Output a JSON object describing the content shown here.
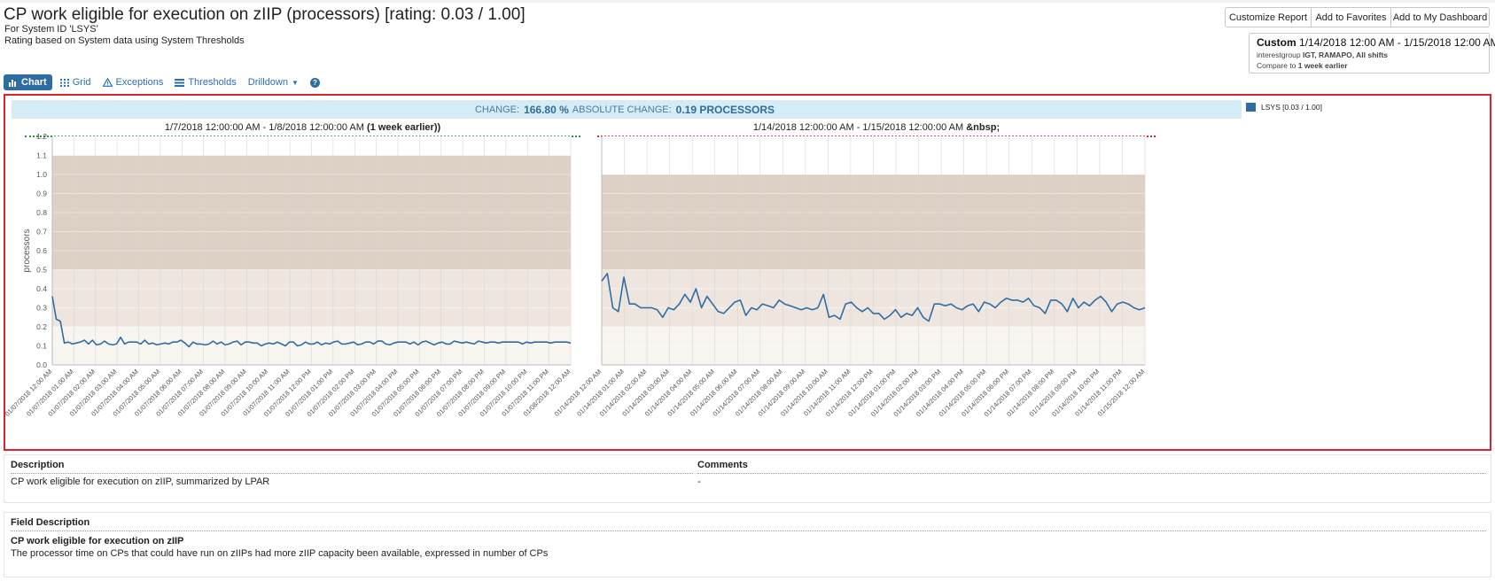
{
  "header": {
    "title": "CP work eligible for execution on zIIP (processors) [rating: 0.03 / 1.00]",
    "system_line": "For System ID 'LSYS'",
    "rating_line": "Rating based on System data using System Thresholds"
  },
  "actions": {
    "customize": "Customize Report",
    "favorites": "Add to Favorites",
    "dashboard": "Add to My Dashboard"
  },
  "range": {
    "label": "Custom",
    "dates": "1/14/2018 12:00 AM - 1/15/2018 12:00 AM",
    "filter_prefix": "interestgroup",
    "filter_value": "IGT, RAMAPO, All shifts",
    "compare_prefix": "Compare to",
    "compare_value": "1 week earlier"
  },
  "tabs": {
    "chart": "Chart",
    "grid": "Grid",
    "exceptions": "Exceptions",
    "thresholds": "Thresholds",
    "drilldown": "Drilldown"
  },
  "change": {
    "change_label": "CHANGE:",
    "change_value": "166.80 %",
    "abs_label": "ABSOLUTE CHANGE:",
    "abs_value": "0.19 PROCESSORS"
  },
  "legend": {
    "label": "LSYS [0.03 / 1.00]",
    "color": "#2e6da4"
  },
  "chart_data": [
    {
      "type": "line",
      "title": "1/7/2018 12:00:00 AM - 1/8/2018 12:00:00 AM",
      "title_suffix": "(1 week earlier))",
      "ylabel": "processors",
      "ylim": [
        0,
        1.2
      ],
      "yticks": [
        "0.0",
        "0.1",
        "0.2",
        "0.3",
        "0.4",
        "0.5",
        "0.6",
        "0.7",
        "0.8",
        "0.9",
        "1.0",
        "1.1",
        "1.2"
      ],
      "threshold_bands": [
        {
          "from": 0.5,
          "to": 1.1,
          "color": "#ddd0c4"
        },
        {
          "from": 0.2,
          "to": 0.5,
          "color": "#efe5df"
        },
        {
          "from": 0.0,
          "to": 0.2,
          "color": "#f8f5f1"
        }
      ],
      "xticks": [
        "01/07/2018 12:00 AM",
        "01/07/2018 01:00 AM",
        "01/07/2018 02:00 AM",
        "01/07/2018 03:00 AM",
        "01/07/2018 04:00 AM",
        "01/07/2018 05:00 AM",
        "01/07/2018 06:00 AM",
        "01/07/2018 07:00 AM",
        "01/07/2018 08:00 AM",
        "01/07/2018 09:00 AM",
        "01/07/2018 10:00 AM",
        "01/07/2018 11:00 AM",
        "01/07/2018 12:00 PM",
        "01/07/2018 01:00 PM",
        "01/07/2018 02:00 PM",
        "01/07/2018 03:00 PM",
        "01/07/2018 04:00 PM",
        "01/07/2018 05:00 PM",
        "01/07/2018 06:00 PM",
        "01/07/2018 07:00 PM",
        "01/07/2018 08:00 PM",
        "01/07/2018 09:00 PM",
        "01/07/2018 10:00 PM",
        "01/07/2018 11:00 PM",
        "01/08/2018 12:00 AM"
      ],
      "series": [
        {
          "name": "LSYS",
          "values": [
            0.36,
            0.24,
            0.23,
            0.115,
            0.12,
            0.11,
            0.115,
            0.12,
            0.13,
            0.11,
            0.13,
            0.105,
            0.11,
            0.125,
            0.11,
            0.105,
            0.11,
            0.145,
            0.11,
            0.12,
            0.12,
            0.12,
            0.11,
            0.13,
            0.11,
            0.115,
            0.105,
            0.11,
            0.115,
            0.11,
            0.12,
            0.12,
            0.13,
            0.115,
            0.095,
            0.12,
            0.11,
            0.11,
            0.105,
            0.11,
            0.125,
            0.11,
            0.12,
            0.105,
            0.11,
            0.12,
            0.125,
            0.105,
            0.12,
            0.12,
            0.115,
            0.115,
            0.1,
            0.11,
            0.115,
            0.11,
            0.12,
            0.11,
            0.1,
            0.12,
            0.12,
            0.1,
            0.105,
            0.12,
            0.11,
            0.11,
            0.12,
            0.105,
            0.115,
            0.11,
            0.12,
            0.125,
            0.11,
            0.11,
            0.115,
            0.12,
            0.105,
            0.11,
            0.12,
            0.12,
            0.11,
            0.125,
            0.125,
            0.11,
            0.105,
            0.115,
            0.12,
            0.12,
            0.12,
            0.11,
            0.12,
            0.105,
            0.12,
            0.125,
            0.115,
            0.105,
            0.115,
            0.12,
            0.11,
            0.11,
            0.125,
            0.12,
            0.115,
            0.12,
            0.115,
            0.11,
            0.125,
            0.12,
            0.115,
            0.12,
            0.12,
            0.115,
            0.12,
            0.12,
            0.12,
            0.12,
            0.12,
            0.11,
            0.12,
            0.115,
            0.12,
            0.12,
            0.12,
            0.12,
            0.115,
            0.12,
            0.12,
            0.12,
            0.12,
            0.115
          ]
        }
      ]
    },
    {
      "type": "line",
      "title": "1/14/2018 12:00:00 AM - 1/15/2018 12:00:00 AM",
      "title_suffix": "&nbsp;",
      "ylim": [
        0,
        1.2
      ],
      "threshold_bands": [
        {
          "from": 0.5,
          "to": 1.0,
          "color": "#ddd0c4"
        },
        {
          "from": 0.2,
          "to": 0.5,
          "color": "#efe5df"
        },
        {
          "from": 0.0,
          "to": 0.2,
          "color": "#f8f5f1"
        }
      ],
      "xticks": [
        "01/14/2018 12:00 AM",
        "01/14/2018 01:00 AM",
        "01/14/2018 02:00 AM",
        "01/14/2018 03:00 AM",
        "01/14/2018 04:00 AM",
        "01/14/2018 05:00 AM",
        "01/14/2018 06:00 AM",
        "01/14/2018 07:00 AM",
        "01/14/2018 08:00 AM",
        "01/14/2018 09:00 AM",
        "01/14/2018 10:00 AM",
        "01/14/2018 11:00 AM",
        "01/14/2018 12:00 PM",
        "01/14/2018 01:00 PM",
        "01/14/2018 02:00 PM",
        "01/14/2018 03:00 PM",
        "01/14/2018 04:00 PM",
        "01/14/2018 05:00 PM",
        "01/14/2018 06:00 PM",
        "01/14/2018 07:00 PM",
        "01/14/2018 08:00 PM",
        "01/14/2018 09:00 PM",
        "01/14/2018 10:00 PM",
        "01/14/2018 11:00 PM",
        "01/15/2018 12:00 AM"
      ],
      "series": [
        {
          "name": "LSYS",
          "values": [
            0.44,
            0.48,
            0.3,
            0.28,
            0.46,
            0.32,
            0.32,
            0.3,
            0.3,
            0.3,
            0.29,
            0.25,
            0.3,
            0.29,
            0.32,
            0.37,
            0.33,
            0.4,
            0.3,
            0.36,
            0.32,
            0.28,
            0.27,
            0.3,
            0.33,
            0.34,
            0.26,
            0.3,
            0.29,
            0.32,
            0.31,
            0.3,
            0.34,
            0.32,
            0.31,
            0.3,
            0.29,
            0.3,
            0.29,
            0.3,
            0.37,
            0.25,
            0.26,
            0.24,
            0.32,
            0.33,
            0.3,
            0.28,
            0.3,
            0.27,
            0.27,
            0.24,
            0.26,
            0.29,
            0.25,
            0.27,
            0.26,
            0.3,
            0.25,
            0.23,
            0.32,
            0.32,
            0.31,
            0.32,
            0.3,
            0.29,
            0.31,
            0.32,
            0.28,
            0.33,
            0.32,
            0.3,
            0.33,
            0.35,
            0.34,
            0.34,
            0.33,
            0.35,
            0.31,
            0.3,
            0.27,
            0.34,
            0.34,
            0.32,
            0.28,
            0.35,
            0.3,
            0.33,
            0.31,
            0.34,
            0.36,
            0.33,
            0.28,
            0.32,
            0.33,
            0.32,
            0.3,
            0.29,
            0.3
          ]
        }
      ]
    }
  ],
  "description": {
    "heading": "Description",
    "text": "CP work eligible for execution on zIIP, summarized by LPAR"
  },
  "comments": {
    "heading": "Comments",
    "text": "-"
  },
  "field_description": {
    "heading": "Field Description",
    "name": "CP work eligible for execution on zIIP",
    "text": "The processor time on CPs that could have run on zIIPs had more zIIP capacity been available, expressed in number of CPs"
  }
}
